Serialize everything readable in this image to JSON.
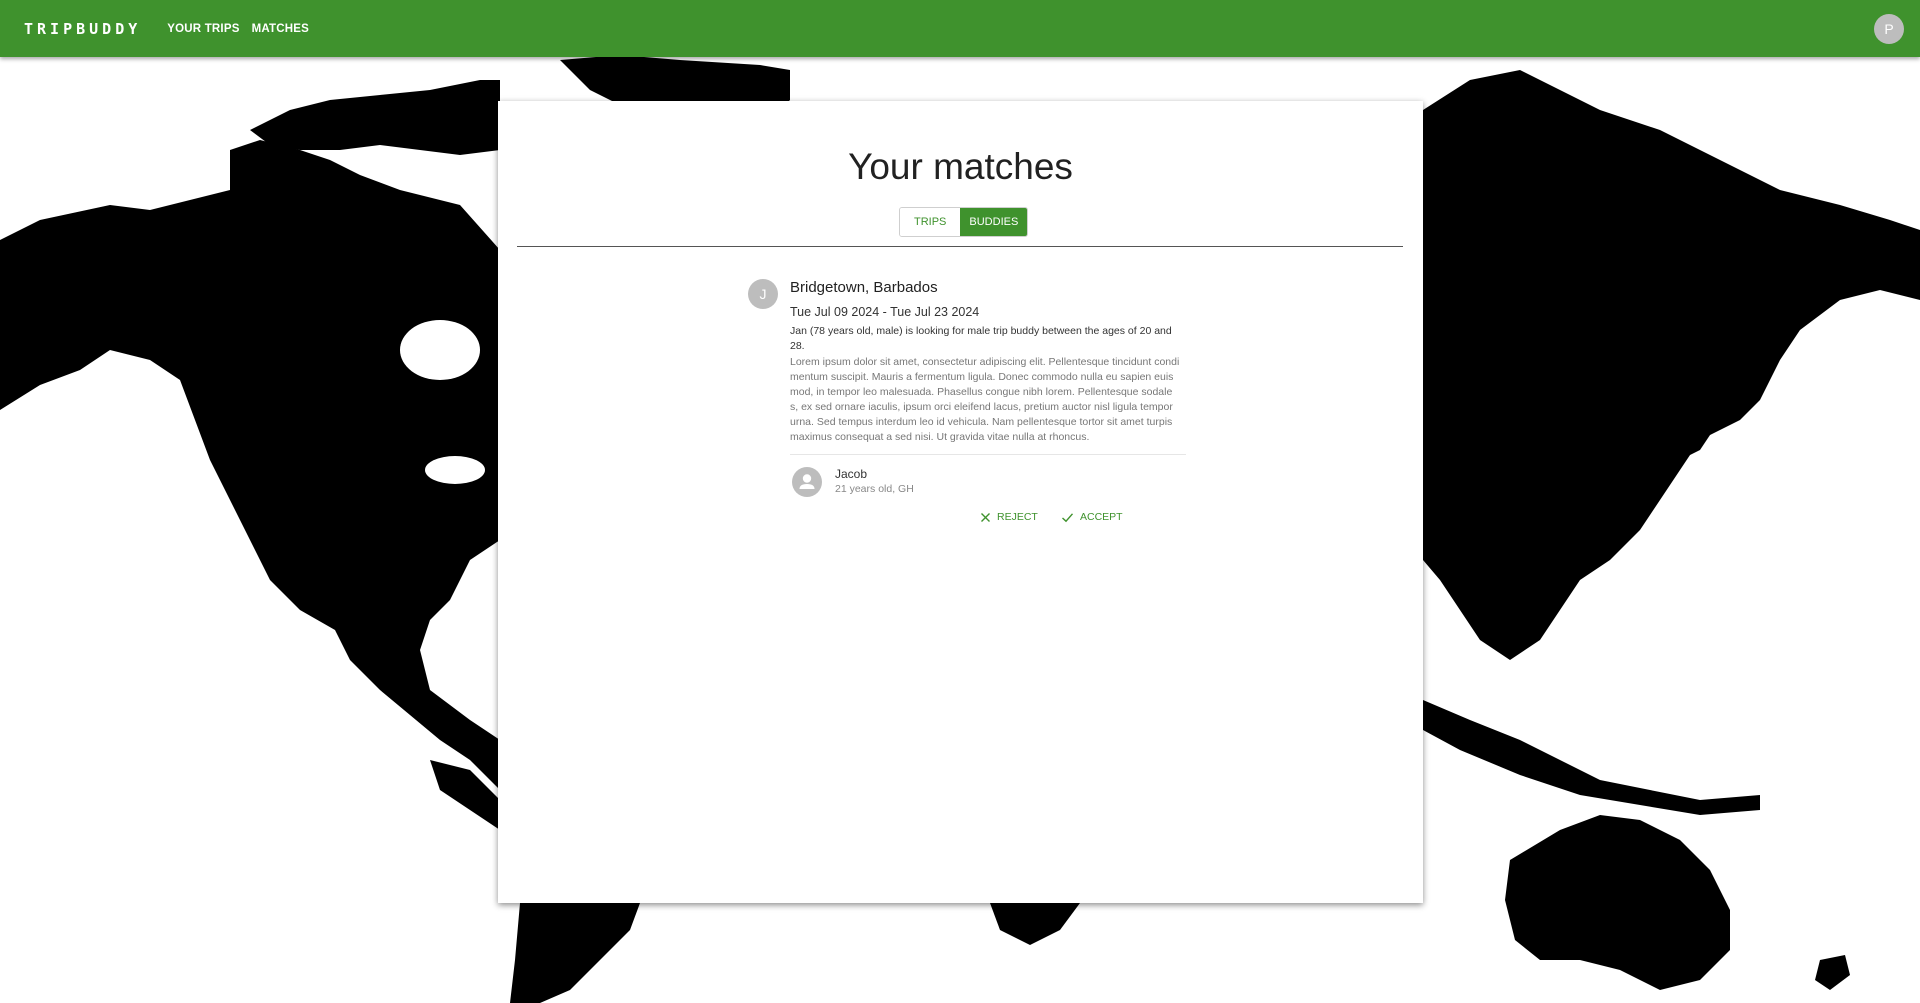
{
  "app": {
    "brand": "TRIPBUDDY",
    "nav": [
      {
        "label": "YOUR TRIPS"
      },
      {
        "label": "MATCHES"
      }
    ],
    "user_initial": "P"
  },
  "page": {
    "title": "Your matches",
    "tabs": [
      {
        "label": "TRIPS",
        "active": false
      },
      {
        "label": "BUDDIES",
        "active": true
      }
    ]
  },
  "match": {
    "initial": "J",
    "destination": "Bridgetown, Barbados",
    "dates": "Tue Jul 09 2024 - Tue Jul 23 2024",
    "seeking": "Jan (78 years old, male) is looking for male trip buddy between the ages of 20 and 28.",
    "description": "Lorem ipsum dolor sit amet, consectetur adipiscing elit. Pellentesque tincidunt condimentum suscipit. Mauris a fermentum ligula. Donec commodo nulla eu sapien euismod, in tempor leo malesuada. Phasellus congue nibh lorem. Pellentesque sodales, ex sed ornare iaculis, ipsum orci eleifend lacus, pretium auctor nisl ligula tempor urna. Sed tempus interdum leo id vehicula. Nam pellentesque tortor sit amet turpis maximus consequat a sed nisi. Ut gravida vitae nulla at rhoncus.",
    "buddy": {
      "name": "Jacob",
      "meta": "21 years old, GH"
    },
    "actions": {
      "reject": "REJECT",
      "accept": "ACCEPT"
    }
  },
  "colors": {
    "primary": "#3f922d",
    "land": "#000000",
    "ocean": "#ffffff"
  }
}
